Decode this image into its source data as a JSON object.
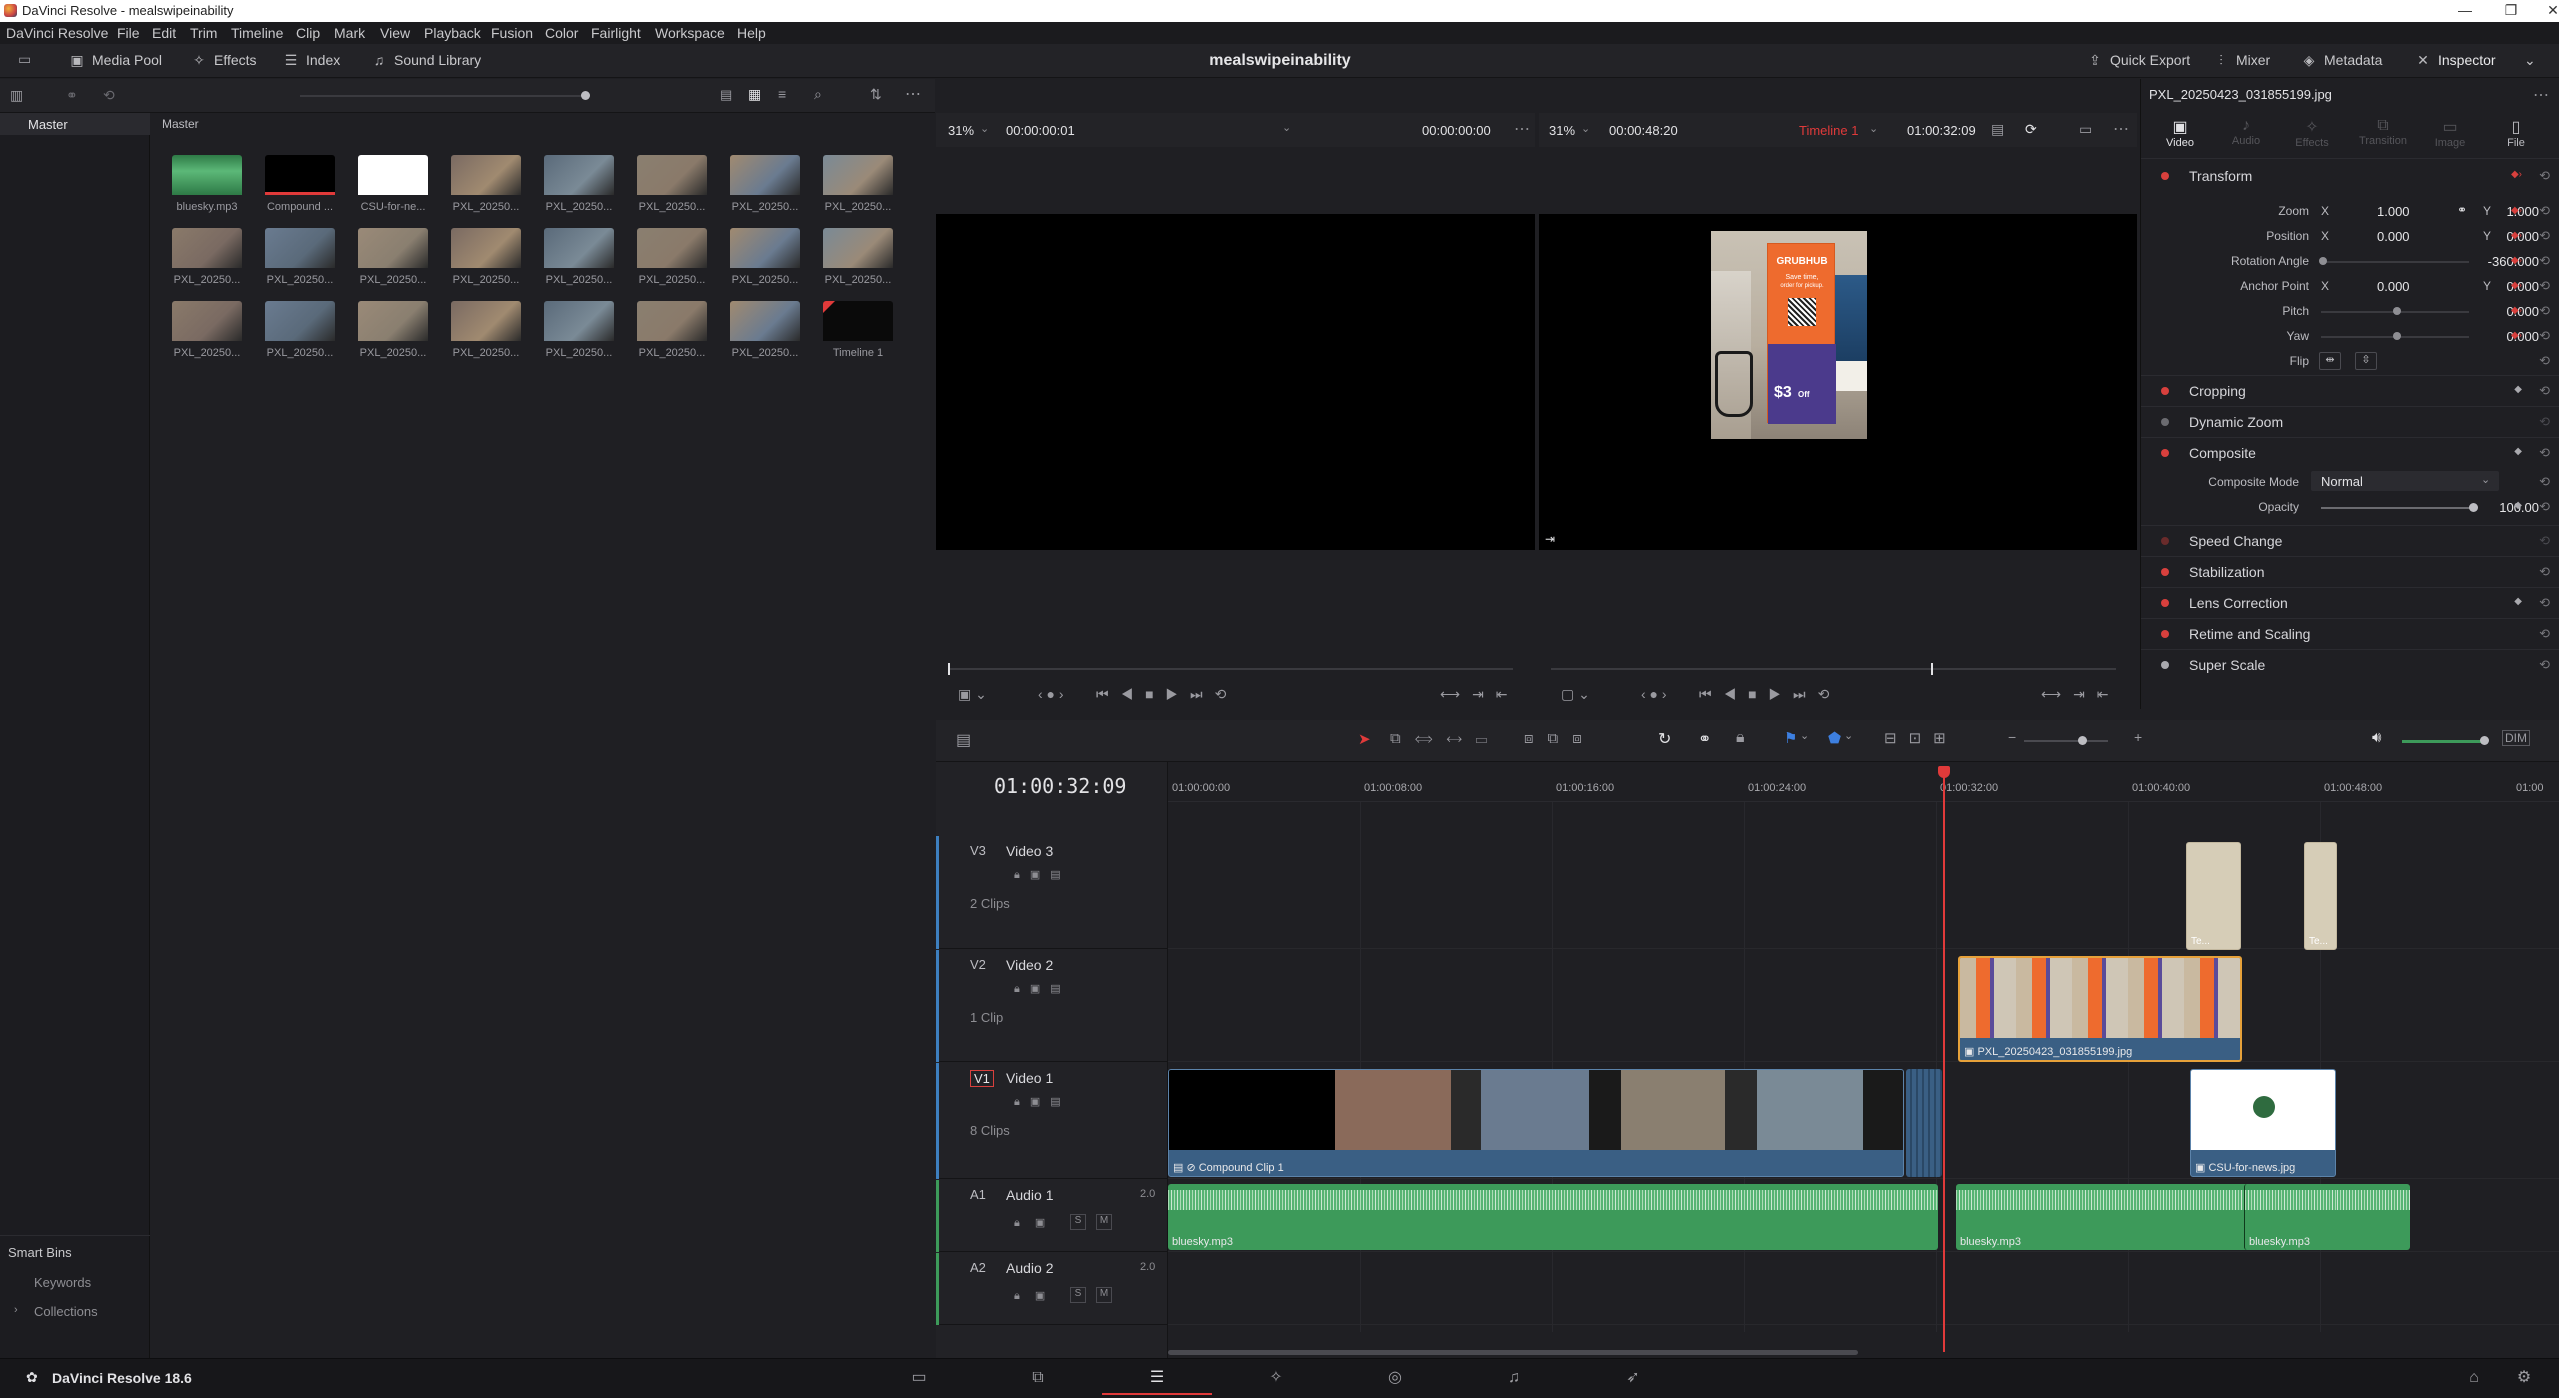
{
  "window": {
    "title": "DaVinci Resolve - mealswipeinability",
    "controls": [
      "—",
      "❐",
      "✕"
    ]
  },
  "menu": [
    "DaVinci Resolve",
    "File",
    "Edit",
    "Trim",
    "Timeline",
    "Clip",
    "Mark",
    "View",
    "Playback",
    "Fusion",
    "Color",
    "Fairlight",
    "Workspace",
    "Help"
  ],
  "toolbar": {
    "media_pool": "Media Pool",
    "effects": "Effects",
    "index": "Index",
    "sound_library": "Sound Library",
    "project_title": "mealswipeinability",
    "quick_export": "Quick Export",
    "mixer": "Mixer",
    "metadata": "Metadata",
    "inspector": "Inspector"
  },
  "media_pool": {
    "bin_header": "Master",
    "breadcrumb": "Master",
    "smart_bins": "Smart Bins",
    "keywords": "Keywords",
    "collections": "Collections",
    "clips": [
      {
        "label": "bluesky.mp3",
        "kind": "audio"
      },
      {
        "label": "Compound ...",
        "kind": "compound"
      },
      {
        "label": "CSU-for-ne...",
        "kind": "white"
      },
      {
        "label": "PXL_20250...",
        "kind": "photo"
      },
      {
        "label": "PXL_20250...",
        "kind": "photo"
      },
      {
        "label": "PXL_20250...",
        "kind": "photo"
      },
      {
        "label": "PXL_20250...",
        "kind": "photo"
      },
      {
        "label": "PXL_20250...",
        "kind": "photo"
      },
      {
        "label": "PXL_20250...",
        "kind": "photo"
      },
      {
        "label": "PXL_20250...",
        "kind": "photo"
      },
      {
        "label": "PXL_20250...",
        "kind": "photo"
      },
      {
        "label": "PXL_20250...",
        "kind": "photo"
      },
      {
        "label": "PXL_20250...",
        "kind": "photo"
      },
      {
        "label": "PXL_20250...",
        "kind": "photo"
      },
      {
        "label": "PXL_20250...",
        "kind": "photo"
      },
      {
        "label": "PXL_20250...",
        "kind": "photo"
      },
      {
        "label": "PXL_20250...",
        "kind": "photo"
      },
      {
        "label": "PXL_20250...",
        "kind": "photo"
      },
      {
        "label": "PXL_20250...",
        "kind": "photo"
      },
      {
        "label": "PXL_20250...",
        "kind": "photo"
      },
      {
        "label": "PXL_20250...",
        "kind": "photo"
      },
      {
        "label": "PXL_20250...",
        "kind": "photo"
      },
      {
        "label": "PXL_20250...",
        "kind": "photo"
      },
      {
        "label": "Timeline 1",
        "kind": "timeline"
      }
    ]
  },
  "source_viewer": {
    "zoom": "31%",
    "timecode": "00:00:00:01",
    "duration": "00:00:00:00"
  },
  "program_viewer": {
    "zoom": "31%",
    "duration": "00:00:48:20",
    "timeline_name": "Timeline 1",
    "timecode": "01:00:32:09"
  },
  "inspector": {
    "clip_name": "PXL_20250423_031855199.jpg",
    "tabs": [
      "Video",
      "Audio",
      "Effects",
      "Transition",
      "Image",
      "File"
    ],
    "transform": {
      "title": "Transform",
      "zoom_label": "Zoom",
      "zoom_x": "1.000",
      "zoom_y": "1.000",
      "position_label": "Position",
      "position_x": "0.000",
      "position_y": "0.000",
      "rotation_label": "Rotation Angle",
      "rotation": "-360.000",
      "anchor_label": "Anchor Point",
      "anchor_x": "0.000",
      "anchor_y": "0.000",
      "pitch_label": "Pitch",
      "pitch": "0.000",
      "yaw_label": "Yaw",
      "yaw": "0.000",
      "flip_label": "Flip",
      "x_label": "X",
      "y_label": "Y"
    },
    "cropping": "Cropping",
    "dynamic_zoom": "Dynamic Zoom",
    "composite": {
      "title": "Composite",
      "mode_label": "Composite Mode",
      "mode": "Normal",
      "opacity_label": "Opacity",
      "opacity": "100.00"
    },
    "speed_change": "Speed Change",
    "stabilization": "Stabilization",
    "lens_correction": "Lens Correction",
    "retime_scaling": "Retime and Scaling",
    "super_scale": "Super Scale"
  },
  "timeline": {
    "timecode": "01:00:32:09",
    "ruler": [
      "01:00:00:00",
      "01:00:08:00",
      "01:00:16:00",
      "01:00:24:00",
      "01:00:32:00",
      "01:00:40:00",
      "01:00:48:00",
      "01:00"
    ],
    "tracks": {
      "v3": {
        "id": "V3",
        "name": "Video 3",
        "count": "2 Clips"
      },
      "v2": {
        "id": "V2",
        "name": "Video 2",
        "count": "1 Clip"
      },
      "v1": {
        "id": "V1",
        "name": "Video 1",
        "count": "8 Clips"
      },
      "a1": {
        "id": "A1",
        "name": "Audio 1",
        "channels": "2.0"
      },
      "a2": {
        "id": "A2",
        "name": "Audio 2",
        "channels": "2.0"
      }
    },
    "clips": {
      "compound": "Compound Clip 1",
      "pxl": "PXL_20250423_031855199.jpg",
      "csu": "CSU-for-news.jpg",
      "te1": "Te...",
      "te2": "Te...",
      "audio1": "bluesky.mp3",
      "audio2": "bluesky.mp3",
      "audio3": "bluesky.mp3"
    },
    "solo": "S",
    "mute": "M"
  },
  "preview_poster": {
    "brand": "GRUBHUB",
    "line1": "Save time,",
    "line2": "order for pickup.",
    "price": "$3",
    "off": "Off"
  },
  "status": {
    "app": "DaVinci Resolve 18.6"
  },
  "colors": {
    "accent": "#d8403d",
    "clip_video": "#3a5f84",
    "clip_audio": "#3d9a5a",
    "playhead": "#e03a3a"
  }
}
